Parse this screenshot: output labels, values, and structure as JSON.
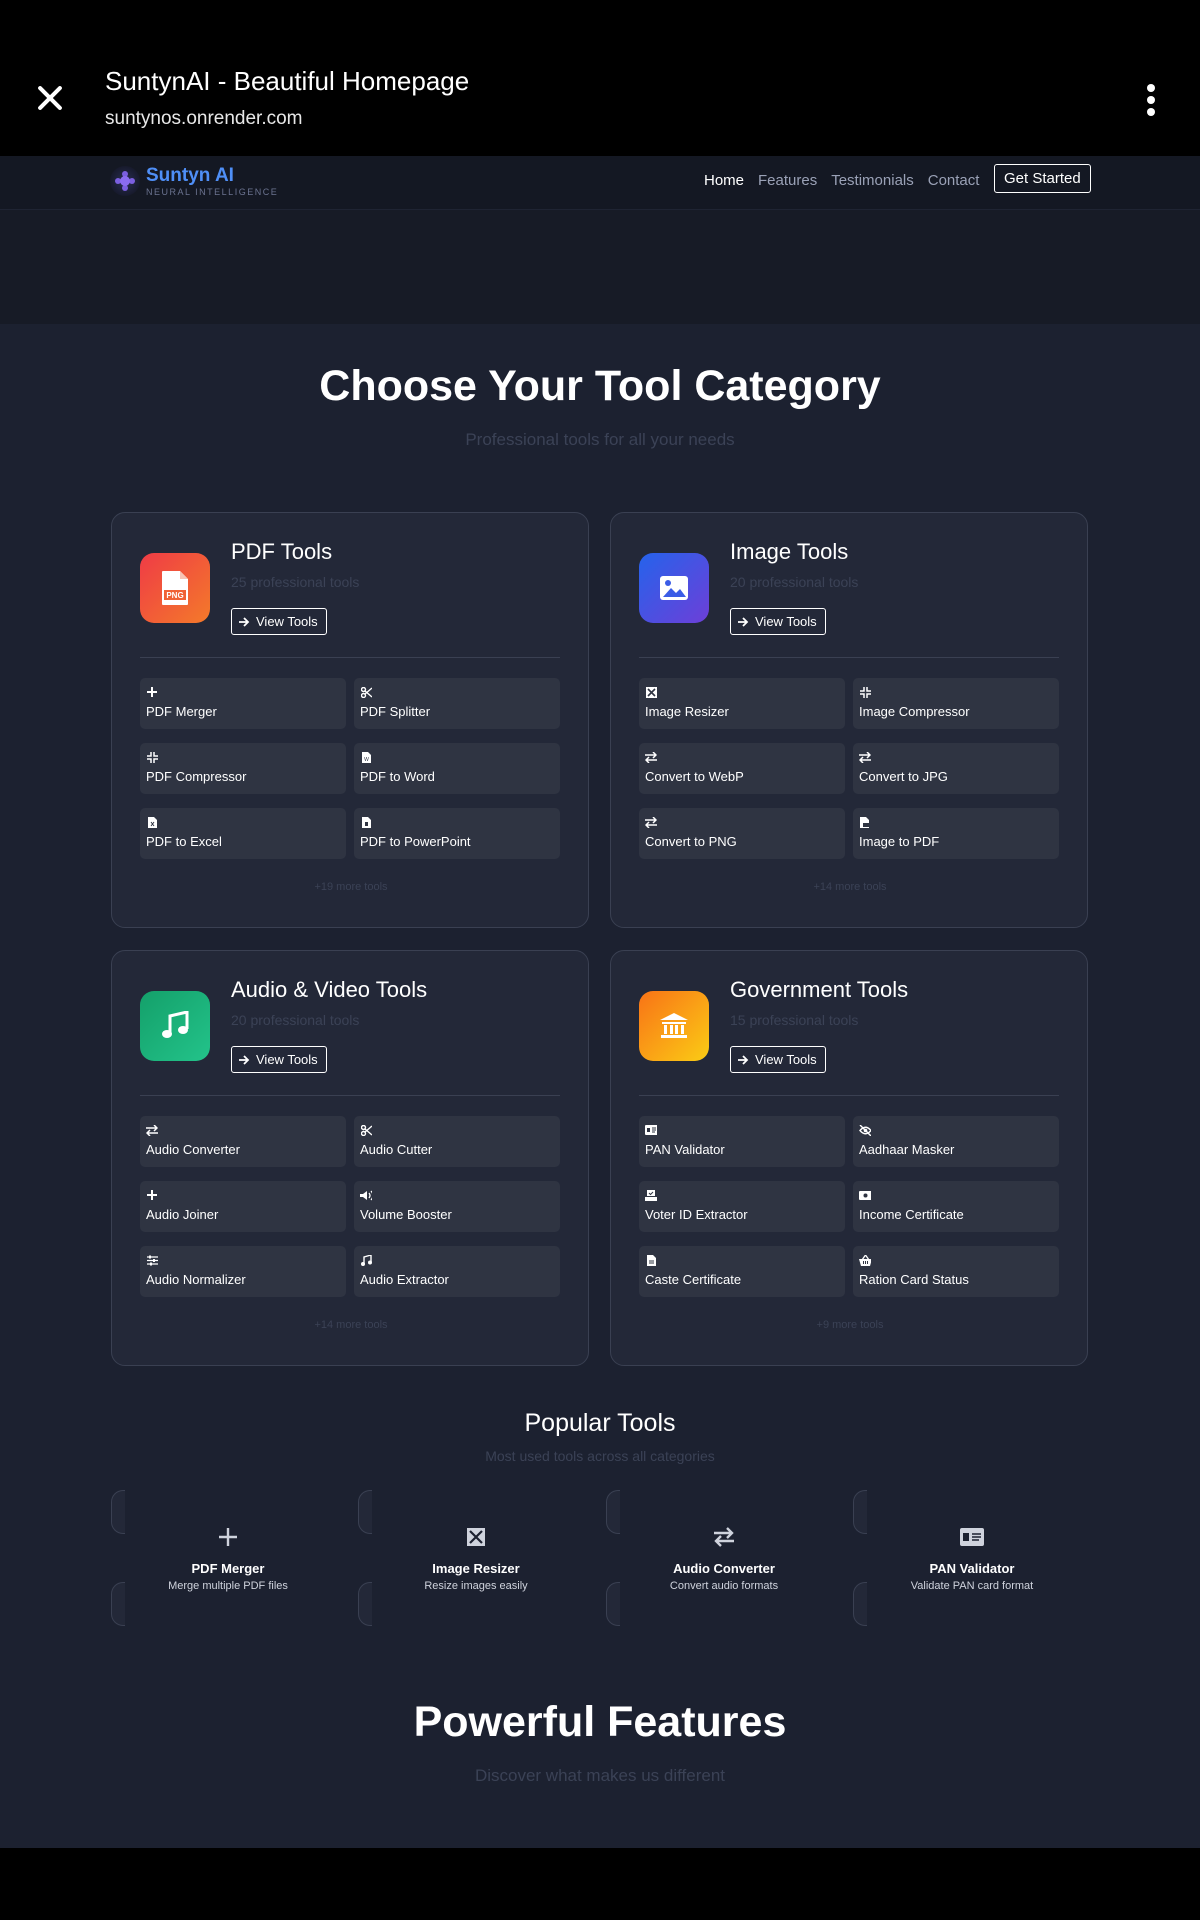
{
  "browser": {
    "title": "SuntynAI - Beautiful Homepage",
    "url": "suntynos.onrender.com"
  },
  "nav": {
    "brand": "Suntyn AI",
    "tagline": "NEURAL INTELLIGENCE",
    "links": [
      "Home",
      "Features",
      "Testimonials",
      "Contact"
    ],
    "cta": "Get Started"
  },
  "categories_section": {
    "title": "Choose Your Tool Category",
    "subtitle": "Professional tools for all your needs"
  },
  "categories": [
    {
      "title": "PDF Tools",
      "count": "25 professional tools",
      "button": "View Tools",
      "more": "+19 more tools",
      "icon": "pdf-file-icon",
      "tools": [
        {
          "name": "PDF Merger",
          "icon": "plus-icon"
        },
        {
          "name": "PDF Splitter",
          "icon": "scissors-icon"
        },
        {
          "name": "PDF Compressor",
          "icon": "compress-icon"
        },
        {
          "name": "PDF to Word",
          "icon": "word-file-icon"
        },
        {
          "name": "PDF to Excel",
          "icon": "excel-file-icon"
        },
        {
          "name": "PDF to PowerPoint",
          "icon": "powerpoint-file-icon"
        }
      ]
    },
    {
      "title": "Image Tools",
      "count": "20 professional tools",
      "button": "View Tools",
      "more": "+14 more tools",
      "icon": "image-icon",
      "tools": [
        {
          "name": "Image Resizer",
          "icon": "expand-icon"
        },
        {
          "name": "Image Compressor",
          "icon": "compress-icon"
        },
        {
          "name": "Convert to WebP",
          "icon": "exchange-icon"
        },
        {
          "name": "Convert to JPG",
          "icon": "exchange-icon"
        },
        {
          "name": "Convert to PNG",
          "icon": "exchange-icon"
        },
        {
          "name": "Image to PDF",
          "icon": "pdf-file-icon"
        }
      ]
    },
    {
      "title": "Audio & Video Tools",
      "count": "20 professional tools",
      "button": "View Tools",
      "more": "+14 more tools",
      "icon": "music-note-icon",
      "tools": [
        {
          "name": "Audio Converter",
          "icon": "exchange-icon"
        },
        {
          "name": "Audio Cutter",
          "icon": "scissors-icon"
        },
        {
          "name": "Audio Joiner",
          "icon": "plus-icon"
        },
        {
          "name": "Volume Booster",
          "icon": "volume-icon"
        },
        {
          "name": "Audio Normalizer",
          "icon": "sliders-icon"
        },
        {
          "name": "Audio Extractor",
          "icon": "music-note-icon"
        }
      ]
    },
    {
      "title": "Government Tools",
      "count": "15 professional tools",
      "button": "View Tools",
      "more": "+9 more tools",
      "icon": "bank-icon",
      "tools": [
        {
          "name": "PAN Validator",
          "icon": "id-card-icon"
        },
        {
          "name": "Aadhaar Masker",
          "icon": "eye-slash-icon"
        },
        {
          "name": "Voter ID Extractor",
          "icon": "vote-icon"
        },
        {
          "name": "Income Certificate",
          "icon": "money-icon"
        },
        {
          "name": "Caste Certificate",
          "icon": "file-icon"
        },
        {
          "name": "Ration Card Status",
          "icon": "basket-icon"
        }
      ]
    }
  ],
  "popular": {
    "title": "Popular Tools",
    "subtitle": "Most used tools across all categories",
    "items": [
      {
        "name": "PDF Merger",
        "desc": "Merge multiple PDF files",
        "icon": "plus-icon"
      },
      {
        "name": "Image Resizer",
        "desc": "Resize images easily",
        "icon": "expand-icon"
      },
      {
        "name": "Audio Converter",
        "desc": "Convert audio formats",
        "icon": "exchange-icon"
      },
      {
        "name": "PAN Validator",
        "desc": "Validate PAN card format",
        "icon": "id-card-icon"
      }
    ]
  },
  "features": {
    "title": "Powerful Features",
    "subtitle": "Discover what makes us different"
  },
  "colors": {
    "pdf_gradient": [
      "#ef3b46",
      "#f47a2a"
    ],
    "image_gradient": [
      "#2563eb",
      "#6d3fd8"
    ],
    "audio_gradient": [
      "#14a06a",
      "#23c38a"
    ],
    "gov_gradient": [
      "#f97316",
      "#facc15"
    ],
    "brand": "#4f8ff7"
  }
}
